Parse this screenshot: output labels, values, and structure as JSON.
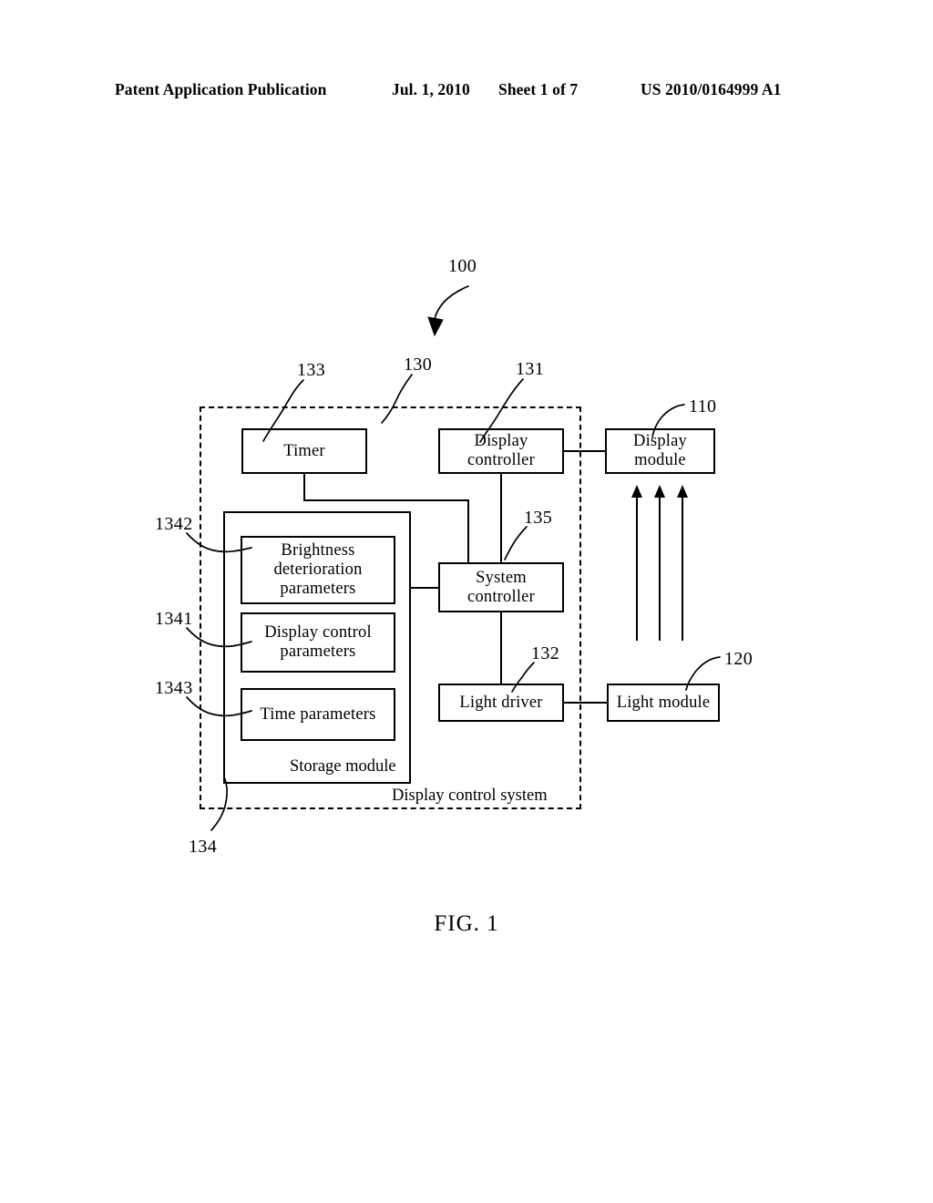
{
  "header": {
    "publication": "Patent Application Publication",
    "date": "Jul. 1, 2010",
    "sheet": "Sheet 1 of 7",
    "patent_number": "US 2010/0164999 A1"
  },
  "figure": {
    "caption": "FIG. 1",
    "system_label": "Display control system",
    "storage_label": "Storage module"
  },
  "blocks": {
    "timer": "Timer",
    "display_controller": "Display\ncontroller",
    "display_module": "Display\nmodule",
    "system_controller": "System\ncontroller",
    "light_driver": "Light driver",
    "light_module": "Light module",
    "brightness_deterioration_parameters": "Brightness\ndeterioration\nparameters",
    "display_control_parameters": "Display control\nparameters",
    "time_parameters": "Time parameters"
  },
  "refs": {
    "system_overall": "100",
    "display_module": "110",
    "light_module": "120",
    "display_control_system": "130",
    "display_controller": "131",
    "light_driver": "132",
    "timer": "133",
    "storage_module": "134",
    "display_control_parameters": "1341",
    "brightness_deterioration_parameters": "1342",
    "time_parameters": "1343",
    "system_controller": "135"
  },
  "colors": {
    "ink": "#000000",
    "paper": "#ffffff"
  }
}
